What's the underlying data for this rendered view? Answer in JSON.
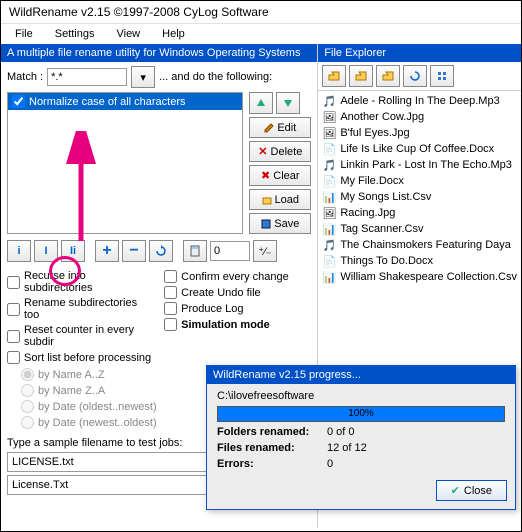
{
  "title": "WildRename v2.15 ©1997-2008 CyLog Software",
  "menu": {
    "file": "File",
    "settings": "Settings",
    "view": "View",
    "help": "Help"
  },
  "banner": "A multiple file rename utility for Windows Operating Systems",
  "match": {
    "label": "Match :",
    "pattern": "*.*",
    "suffix": "... and do the following:"
  },
  "rules": {
    "item0": "Normalize case of all characters"
  },
  "ruleBtns": {
    "edit": "Edit",
    "delete": "Delete",
    "clear": "Clear",
    "load": "Load",
    "save": "Save"
  },
  "counter": "0",
  "opts": {
    "recurse": "Recurse into subdirectories",
    "rensub": "Rename subdirectories too",
    "reset": "Reset counter in every subdir",
    "sort": "Sort list before processing",
    "confirm": "Confirm every change",
    "undo": "Create Undo file",
    "log": "Produce Log",
    "sim": "Simulation mode"
  },
  "radios": {
    "nameaz": "by Name A..Z",
    "nameza": "by Name Z..A",
    "dateon": "by Date (oldest..newest)",
    "dateno": "by Date (newest..oldest)"
  },
  "sample": {
    "label": "Type a sample filename to test jobs:",
    "in": "LICENSE.txt",
    "out": "License.Txt"
  },
  "fe": {
    "title": "File Explorer"
  },
  "files": {
    "f0": "Adele - Rolling In The Deep.Mp3",
    "f1": "Another Cow.Jpg",
    "f2": "B'ful Eyes.Jpg",
    "f3": "Life Is Like Cup Of Coffee.Docx",
    "f4": "Linkin Park - Lost In The Echo.Mp3",
    "f5": "My File.Docx",
    "f6": "My Songs List.Csv",
    "f7": "Racing.Jpg",
    "f8": "Tag Scanner.Csv",
    "f9": "The Chainsmokers Featuring Daya",
    "f10": "Things To Do.Docx",
    "f11": "William Shakespeare Collection.Csv"
  },
  "dlg": {
    "title": "WildRename v2.15 progress...",
    "path": "C:\\ilovefreesoftware",
    "prog": "100%",
    "folders_l": "Folders renamed:",
    "folders_v": "0 of 0",
    "files_l": "Files renamed:",
    "files_v": "12 of 12",
    "errors_l": "Errors:",
    "errors_v": "0",
    "close": "Close"
  }
}
